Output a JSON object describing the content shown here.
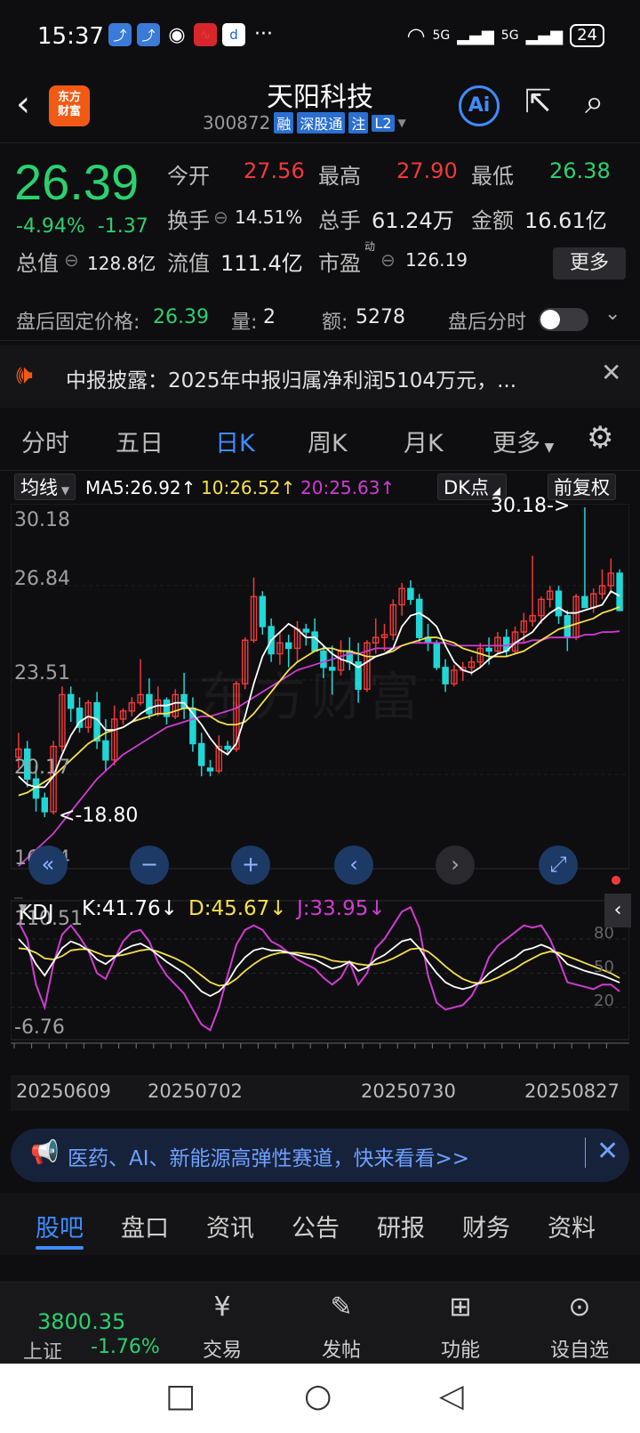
{
  "status_bar": {
    "time": "15:37",
    "battery": "24",
    "net1": "5G",
    "net2": "5G",
    "more": "···"
  },
  "header": {
    "stock_name": "天阳科技",
    "stock_code": "300872",
    "logo_line1": "东方",
    "logo_line2": "财富",
    "tags": [
      "融",
      "深股通",
      "注",
      "L2"
    ],
    "ai_label": "Ai"
  },
  "quote": {
    "price": "26.39",
    "change_pct": "-4.94%",
    "change_abs": "-1.37",
    "open_label": "今开",
    "open": "27.56",
    "high_label": "最高",
    "high": "27.90",
    "low_label": "最低",
    "low": "26.38",
    "turnover_label": "换手",
    "turnover": "14.51%",
    "volume_label": "总手",
    "volume": "61.24万",
    "amount_label": "金额",
    "amount": "16.61亿",
    "mcap_label": "总值",
    "mcap": "128.8亿",
    "float_label": "流值",
    "float_mcap": "111.4亿",
    "pe_label": "市盈",
    "pe_sup": "动",
    "pe": "126.19",
    "more_button": "更多"
  },
  "after_hours": {
    "fixed_price_label": "盘后固定价格:",
    "fixed_price": "26.39",
    "vol_label": "量:",
    "vol": "2",
    "amt_label": "额:",
    "amt": "5278",
    "intraday_label": "盘后分时"
  },
  "notice": {
    "text": "中报披露：2025年中报归属净利润5104万元，..."
  },
  "chart_tabs": [
    "分时",
    "五日",
    "日K",
    "周K",
    "月K",
    "更多"
  ],
  "active_chart_tab": "日K",
  "ma_bar": {
    "mode": "均线",
    "ma5": "MA5:26.92↑",
    "ma10": "10:26.52↑",
    "ma20": "20:25.63↑",
    "dk_button": "DK点",
    "adjust_button": "前复权"
  },
  "price_axis": [
    "30.18",
    "26.84",
    "23.51",
    "20.17",
    "16.84"
  ],
  "markers": {
    "high": "30.18->",
    "low": "<-18.80"
  },
  "kdj": {
    "name": "KDJ",
    "k": "K:41.76↓",
    "d": "D:45.67↓",
    "j": "J:33.95↓",
    "axis_top": "110.51",
    "axis_bottom": "-6.76",
    "levels": [
      "80",
      "50",
      "20"
    ]
  },
  "dates": [
    "20250609",
    "20250702",
    "20250730",
    "20250827"
  ],
  "promo": {
    "text": "医药、AI、新能源高弹性赛道，快来看看>>"
  },
  "sub_tabs": [
    "股吧",
    "盘口",
    "资讯",
    "公告",
    "研报",
    "财务",
    "资料"
  ],
  "bottom": {
    "index_value": "3800.35",
    "index_name": "上证",
    "index_change": "-1.76%",
    "items": [
      "交易",
      "发帖",
      "功能",
      "设自选"
    ]
  },
  "colors": {
    "up": "#f03a3a",
    "down": "#2ad16e",
    "accent": "#3f8cff",
    "ma5": "#ffffff",
    "ma10": "#f5e04a",
    "ma20": "#d23bd2"
  },
  "chart_data": {
    "type": "candlestick",
    "ylim": [
      16.84,
      30.18
    ],
    "candles": [
      [
        21.0,
        21.9,
        20.6,
        21.3
      ],
      [
        21.3,
        21.6,
        19.9,
        20.2
      ],
      [
        20.2,
        20.7,
        19.0,
        19.5
      ],
      [
        19.5,
        19.7,
        18.8,
        19.0
      ],
      [
        19.0,
        21.6,
        18.9,
        21.4
      ],
      [
        21.4,
        23.6,
        21.2,
        23.3
      ],
      [
        23.3,
        23.6,
        22.3,
        22.8
      ],
      [
        22.8,
        23.2,
        21.9,
        22.1
      ],
      [
        22.1,
        23.1,
        21.9,
        23.0
      ],
      [
        23.0,
        23.4,
        21.3,
        21.6
      ],
      [
        21.6,
        22.4,
        20.5,
        20.9
      ],
      [
        20.9,
        22.9,
        20.7,
        22.4
      ],
      [
        22.4,
        22.8,
        22.2,
        22.7
      ],
      [
        22.7,
        23.2,
        22.5,
        23.0
      ],
      [
        23.0,
        24.6,
        22.9,
        23.3
      ],
      [
        23.3,
        23.9,
        22.4,
        22.6
      ],
      [
        22.6,
        23.6,
        22.5,
        23.1
      ],
      [
        23.1,
        23.2,
        22.2,
        22.5
      ],
      [
        22.5,
        23.5,
        22.4,
        23.3
      ],
      [
        23.3,
        24.1,
        22.4,
        22.8
      ],
      [
        22.8,
        23.2,
        21.2,
        21.5
      ],
      [
        21.5,
        21.9,
        20.3,
        20.7
      ],
      [
        20.6,
        20.9,
        20.3,
        20.5
      ],
      [
        20.5,
        21.8,
        20.4,
        21.4
      ],
      [
        21.4,
        21.6,
        21.1,
        21.3
      ],
      [
        21.3,
        23.8,
        21.2,
        23.7
      ],
      [
        23.7,
        25.4,
        23.5,
        25.3
      ],
      [
        25.3,
        27.6,
        25.2,
        26.9
      ],
      [
        26.9,
        27.1,
        25.5,
        25.8
      ],
      [
        25.8,
        26.1,
        24.5,
        24.8
      ],
      [
        24.8,
        25.6,
        24.4,
        25.2
      ],
      [
        25.2,
        25.5,
        24.3,
        25.0
      ],
      [
        25.0,
        26.0,
        24.5,
        25.7
      ],
      [
        25.7,
        25.9,
        25.1,
        25.6
      ],
      [
        25.6,
        26.1,
        24.9,
        24.9
      ],
      [
        24.9,
        25.1,
        23.9,
        24.3
      ],
      [
        24.3,
        25.1,
        23.3,
        24.2
      ],
      [
        24.2,
        25.3,
        24.0,
        24.9
      ],
      [
        24.9,
        25.4,
        24.2,
        24.5
      ],
      [
        24.5,
        25.2,
        23.0,
        23.5
      ],
      [
        23.5,
        25.3,
        23.4,
        25.2
      ],
      [
        25.2,
        26.1,
        24.8,
        25.4
      ],
      [
        25.4,
        25.9,
        24.9,
        25.5
      ],
      [
        25.5,
        26.8,
        25.3,
        26.6
      ],
      [
        26.6,
        27.4,
        26.2,
        27.2
      ],
      [
        27.2,
        27.5,
        26.6,
        26.8
      ],
      [
        26.8,
        27.0,
        25.2,
        25.4
      ],
      [
        25.4,
        25.9,
        24.9,
        25.2
      ],
      [
        25.2,
        25.3,
        24.2,
        24.3
      ],
      [
        24.3,
        24.6,
        23.4,
        23.7
      ],
      [
        23.7,
        24.4,
        23.6,
        24.2
      ],
      [
        24.2,
        24.5,
        23.8,
        24.3
      ],
      [
        24.3,
        24.7,
        24.0,
        24.5
      ],
      [
        24.5,
        25.2,
        24.3,
        25.0
      ],
      [
        25.0,
        25.4,
        24.4,
        24.9
      ],
      [
        24.9,
        25.6,
        24.8,
        25.4
      ],
      [
        25.4,
        25.7,
        24.7,
        24.9
      ],
      [
        24.9,
        25.8,
        24.8,
        25.6
      ],
      [
        25.6,
        26.3,
        25.2,
        26.0
      ],
      [
        26.0,
        28.4,
        25.8,
        26.2
      ],
      [
        26.2,
        26.9,
        25.9,
        26.8
      ],
      [
        26.8,
        27.3,
        26.5,
        27.1
      ],
      [
        27.1,
        27.3,
        25.9,
        26.2
      ],
      [
        26.2,
        26.4,
        24.9,
        25.4
      ],
      [
        25.4,
        27.0,
        25.3,
        26.9
      ],
      [
        26.9,
        30.18,
        26.7,
        26.5
      ],
      [
        26.5,
        27.2,
        26.3,
        27.0
      ],
      [
        27.0,
        27.9,
        26.8,
        27.3
      ],
      [
        27.3,
        28.3,
        27.0,
        27.76
      ],
      [
        27.76,
        27.9,
        26.38,
        26.39
      ]
    ],
    "ma5": [
      20.3,
      20.0,
      19.9,
      19.9,
      20.3,
      21.1,
      21.8,
      22.3,
      22.5,
      22.4,
      22.0,
      22.0,
      22.1,
      22.3,
      22.6,
      22.8,
      22.9,
      22.9,
      23.0,
      23.0,
      22.6,
      22.2,
      21.7,
      21.3,
      21.1,
      21.5,
      22.5,
      23.7,
      24.7,
      25.3,
      25.6,
      25.9,
      25.7,
      25.4,
      25.4,
      25.1,
      24.8,
      24.6,
      24.5,
      24.3,
      24.5,
      24.7,
      24.8,
      25.0,
      25.8,
      26.2,
      26.3,
      26.1,
      25.8,
      25.1,
      24.5,
      24.2,
      24.1,
      24.3,
      24.6,
      24.8,
      24.9,
      25.2,
      25.4,
      25.6,
      26.0,
      26.3,
      26.5,
      26.3,
      26.3,
      26.4,
      26.5,
      26.6,
      27.1,
      26.92
    ],
    "ma10": [
      19.6,
      19.7,
      19.9,
      20.1,
      20.3,
      20.6,
      20.9,
      21.2,
      21.5,
      21.7,
      21.9,
      22.0,
      22.1,
      22.3,
      22.4,
      22.5,
      22.6,
      22.6,
      22.7,
      22.8,
      22.8,
      22.7,
      22.5,
      22.3,
      22.2,
      22.2,
      22.3,
      22.6,
      23.0,
      23.4,
      23.8,
      24.2,
      24.5,
      24.7,
      24.9,
      25.0,
      25.0,
      24.9,
      24.9,
      24.8,
      24.7,
      24.7,
      24.8,
      24.9,
      25.1,
      25.2,
      25.3,
      25.4,
      25.4,
      25.3,
      25.2,
      25.0,
      24.9,
      24.8,
      24.7,
      24.7,
      24.7,
      24.8,
      24.9,
      25.1,
      25.3,
      25.5,
      25.7,
      25.8,
      25.9,
      26.0,
      26.1,
      26.3,
      26.4,
      26.52
    ],
    "ma20": [
      17.0,
      17.3,
      17.6,
      17.9,
      18.2,
      18.6,
      19.0,
      19.4,
      19.8,
      20.2,
      20.5,
      20.8,
      21.1,
      21.3,
      21.5,
      21.7,
      21.9,
      22.1,
      22.2,
      22.3,
      22.4,
      22.5,
      22.5,
      22.6,
      22.7,
      22.8,
      23.0,
      23.2,
      23.4,
      23.6,
      23.8,
      24.0,
      24.2,
      24.3,
      24.4,
      24.5,
      24.6,
      24.7,
      24.8,
      24.8,
      24.9,
      25.0,
      25.0,
      25.0,
      25.1,
      25.2,
      25.2,
      25.2,
      25.2,
      25.2,
      25.1,
      25.1,
      25.1,
      25.1,
      25.1,
      25.1,
      25.1,
      25.2,
      25.2,
      25.3,
      25.3,
      25.4,
      25.4,
      25.4,
      25.4,
      25.5,
      25.5,
      25.6,
      25.6,
      25.63
    ],
    "kdj_k": [
      80,
      72,
      58,
      48,
      60,
      72,
      78,
      75,
      70,
      62,
      58,
      64,
      70,
      74,
      76,
      72,
      66,
      60,
      55,
      50,
      42,
      34,
      30,
      34,
      42,
      55,
      64,
      70,
      72,
      70,
      70,
      68,
      66,
      64,
      62,
      58,
      54,
      56,
      60,
      52,
      55,
      62,
      66,
      72,
      78,
      80,
      72,
      60,
      50,
      42,
      38,
      36,
      38,
      42,
      50,
      55,
      60,
      64,
      70,
      72,
      75,
      72,
      66,
      58,
      55,
      52,
      50,
      48,
      45,
      41.76
    ],
    "kdj_d": [
      72,
      71,
      68,
      63,
      62,
      65,
      70,
      71,
      71,
      68,
      65,
      65,
      66,
      68,
      70,
      71,
      69,
      66,
      63,
      59,
      54,
      48,
      42,
      39,
      40,
      45,
      52,
      58,
      63,
      66,
      68,
      68,
      68,
      67,
      66,
      64,
      61,
      60,
      60,
      58,
      57,
      58,
      60,
      63,
      67,
      71,
      72,
      69,
      63,
      56,
      50,
      45,
      42,
      41,
      43,
      46,
      50,
      54,
      59,
      63,
      67,
      69,
      68,
      65,
      62,
      59,
      56,
      53,
      50,
      45.67
    ],
    "kdj_j": [
      95,
      80,
      40,
      20,
      58,
      84,
      92,
      82,
      70,
      50,
      45,
      62,
      78,
      86,
      88,
      78,
      60,
      48,
      40,
      32,
      18,
      5,
      0,
      20,
      48,
      75,
      88,
      92,
      88,
      78,
      74,
      68,
      62,
      58,
      54,
      46,
      40,
      46,
      60,
      40,
      50,
      72,
      80,
      92,
      104,
      108,
      90,
      48,
      24,
      18,
      20,
      22,
      30,
      44,
      64,
      74,
      80,
      86,
      92,
      90,
      92,
      80,
      62,
      42,
      40,
      38,
      36,
      40,
      40,
      33.95
    ]
  }
}
